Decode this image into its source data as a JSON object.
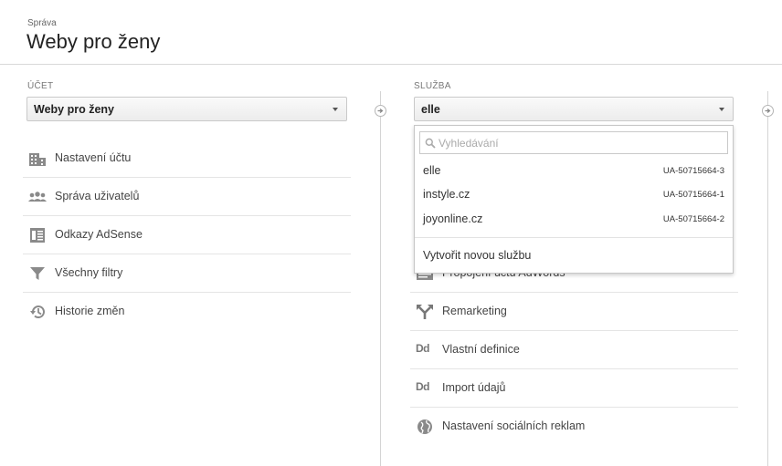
{
  "header": {
    "breadcrumb": "Správa",
    "title": "Weby pro ženy"
  },
  "account": {
    "label": "ÚČET",
    "selected": "Weby pro ženy",
    "items": [
      {
        "label": "Nastavení účtu",
        "icon": "building-icon"
      },
      {
        "label": "Správa uživatelů",
        "icon": "users-icon"
      },
      {
        "label": "Odkazy AdSense",
        "icon": "adsense-icon"
      },
      {
        "label": "Všechny filtry",
        "icon": "filter-icon"
      },
      {
        "label": "Historie změn",
        "icon": "history-icon"
      }
    ]
  },
  "property": {
    "label": "SLUŽBA",
    "selected": "elle",
    "items": [
      {
        "label": "Propojení účtu AdWords",
        "icon": "adwords-icon"
      },
      {
        "label": "Remarketing",
        "icon": "remarketing-icon"
      },
      {
        "label": "Vlastní definice",
        "icon": "dd-icon",
        "icon_text": "Dd"
      },
      {
        "label": "Import údajů",
        "icon": "dd-icon",
        "icon_text": "Dd"
      },
      {
        "label": "Nastavení sociálních reklam",
        "icon": "globe-icon"
      }
    ]
  },
  "dropdown": {
    "search_placeholder": "Vyhledávání",
    "options": [
      {
        "name": "elle",
        "id": "UA-50715664-3"
      },
      {
        "name": "instyle.cz",
        "id": "UA-50715664-1"
      },
      {
        "name": "joyonline.cz",
        "id": "UA-50715664-2"
      }
    ],
    "create_label": "Vytvořit novou službu"
  }
}
